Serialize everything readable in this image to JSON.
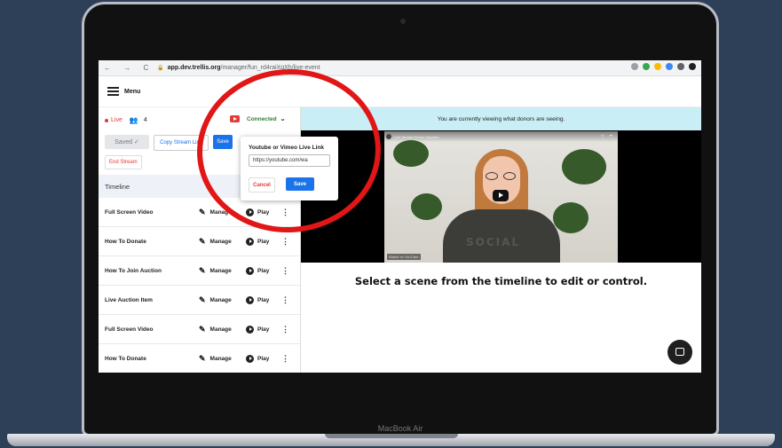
{
  "device": {
    "brand": "MacBook Air"
  },
  "browser": {
    "nav": "← → C",
    "url_domain": "app.dev.trellis.org",
    "url_path": "/manager/fun_rd4raiXgXh/live-event"
  },
  "header": {
    "menu_label": "Menu"
  },
  "status": {
    "live_label": "Live",
    "viewer_count": "4",
    "connection_label": "Connected"
  },
  "controls": {
    "saved_label": "Saved ✓",
    "copy_stream_label": "Copy Stream Link",
    "save_label": "Save",
    "end_stream_label": "End Stream"
  },
  "timeline": {
    "heading": "Timeline",
    "manage_label": "Manage",
    "play_label": "Play",
    "items": [
      {
        "name": "Full Screen Video"
      },
      {
        "name": "How To Donate"
      },
      {
        "name": "How To Join Auction"
      },
      {
        "name": "Live Auction Item"
      },
      {
        "name": "Full Screen Video"
      },
      {
        "name": "How To Donate"
      }
    ]
  },
  "popup": {
    "title": "Youtube or Vimeo Live Link",
    "input_value": "https://youtube.com/wa",
    "cancel_label": "Cancel",
    "save_label": "Save"
  },
  "viewer": {
    "banner": "You are currently viewing what donors are seeing.",
    "video_title": "Live Stream Promo Speaker",
    "sweater_text": "SOCIAL",
    "watch_on": "Watch on YouTube",
    "select_message": "Select a scene from the timeline to edit or control."
  },
  "colors": {
    "live_red": "#e53935",
    "connected_green": "#2e7d32",
    "primary_blue": "#1a73e8",
    "banner_bg": "#c9eef6",
    "annotation_red": "#e11616"
  }
}
